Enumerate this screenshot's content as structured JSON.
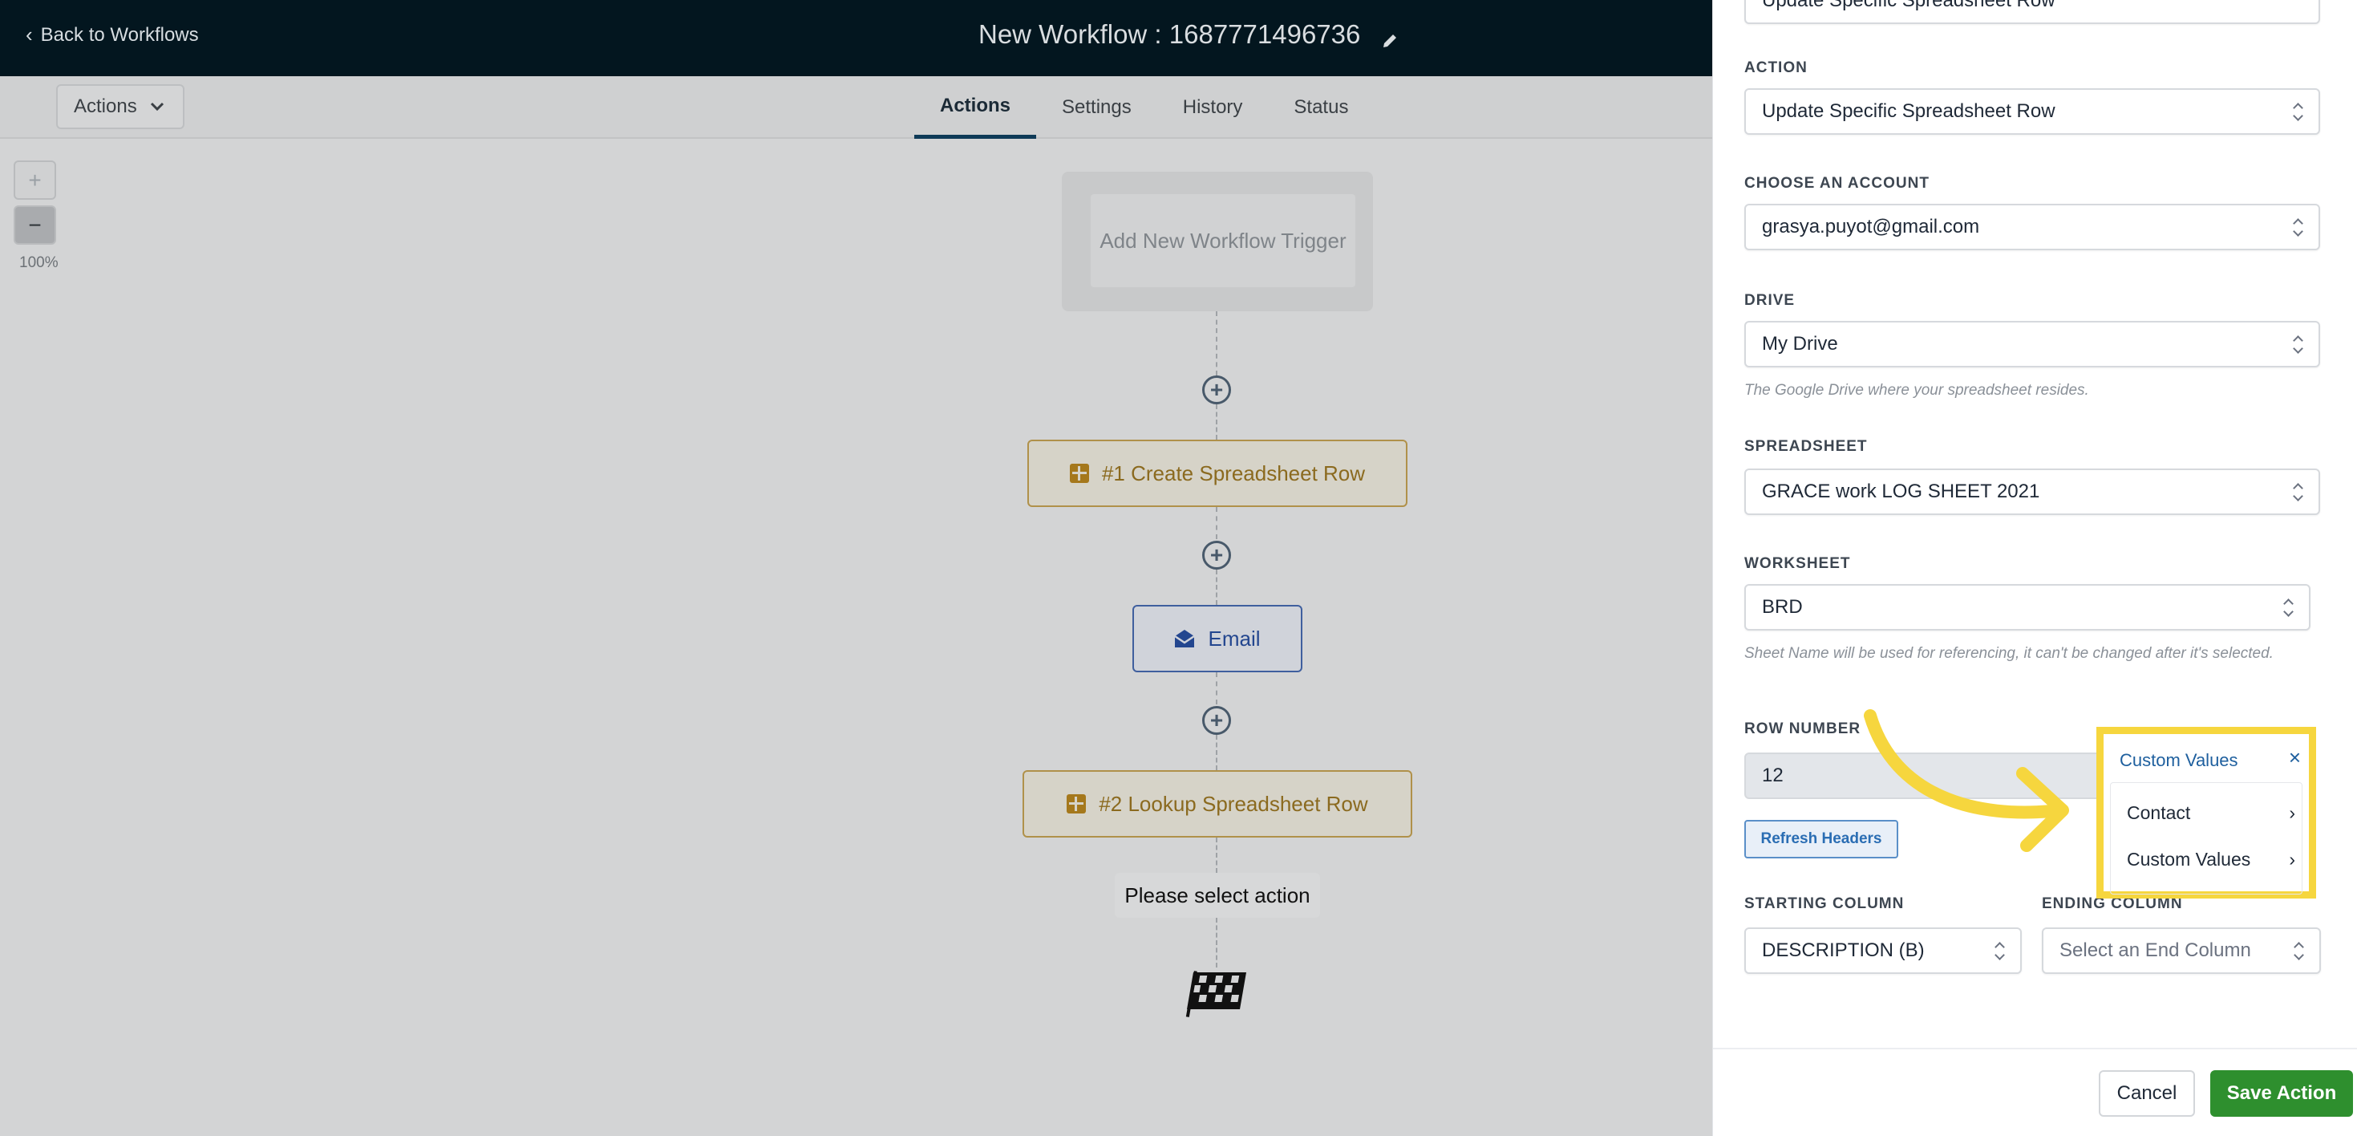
{
  "header": {
    "back_label": "Back to Workflows",
    "title": "New Workflow : 1687771496736"
  },
  "toolbar": {
    "actions_label": "Actions",
    "tabs": [
      {
        "label": "Actions"
      },
      {
        "label": "Settings"
      },
      {
        "label": "History"
      },
      {
        "label": "Status"
      }
    ]
  },
  "zoom": {
    "plus": "+",
    "minus": "−",
    "level": "100%"
  },
  "canvas": {
    "trigger_label": "Add New Workflow Trigger",
    "nodes": {
      "create_row": "#1 Create Spreadsheet Row",
      "email": "Email",
      "lookup_row": "#2 Lookup Spreadsheet Row"
    },
    "placeholder": "Please select action"
  },
  "panel": {
    "top_value": "Update Specific Spreadsheet Row",
    "action": {
      "label": "ACTION",
      "value": "Update Specific Spreadsheet Row"
    },
    "account": {
      "label": "CHOOSE AN ACCOUNT",
      "value": "grasya.puyot@gmail.com"
    },
    "drive": {
      "label": "DRIVE",
      "value": "My Drive",
      "help": "The Google Drive where your spreadsheet resides."
    },
    "spreadsheet": {
      "label": "SPREADSHEET",
      "value": "GRACE work LOG SHEET 2021"
    },
    "worksheet": {
      "label": "WORKSHEET",
      "value": "BRD",
      "help": "Sheet Name will be used for referencing, it can't be changed after it's selected."
    },
    "row_number": {
      "label": "ROW NUMBER",
      "value": "12"
    },
    "refresh_label": "Refresh Headers",
    "starting_column": {
      "label": "STARTING COLUMN",
      "value": "DESCRIPTION (B)"
    },
    "ending_column": {
      "label": "ENDING COLUMN",
      "placeholder": "Select an End Column"
    },
    "cancel_label": "Cancel",
    "save_label": "Save Action"
  },
  "popover": {
    "title": "Custom Values",
    "close": "×",
    "items": [
      {
        "label": "Contact"
      },
      {
        "label": "Custom Values"
      }
    ]
  },
  "colors": {
    "header_bg": "#03161f",
    "tab_active": "#0e3a57",
    "save_button": "#2e8f2e",
    "highlight": "#f6d63e",
    "sheet_node": "#b0914a",
    "email_node": "#3f5f9e"
  }
}
